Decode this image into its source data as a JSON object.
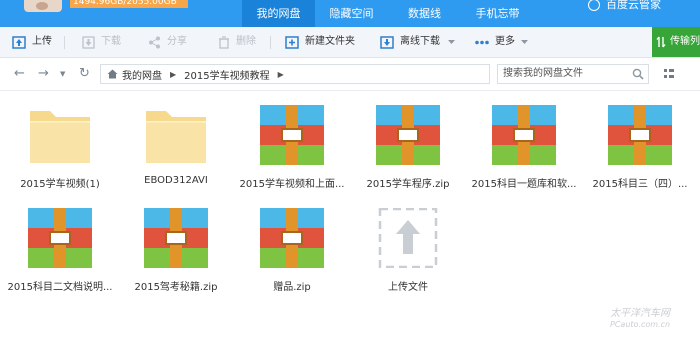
{
  "header": {
    "quota_text": "1494.96GB/2055.00GB",
    "nav": [
      {
        "label": "我的网盘",
        "active": true
      },
      {
        "label": "隐藏空间",
        "active": false
      },
      {
        "label": "数据线",
        "active": false
      },
      {
        "label": "手机忘带",
        "active": false
      }
    ],
    "right_text": "百度云管家"
  },
  "toolbar": {
    "upload": "上传",
    "download": "下载",
    "share": "分享",
    "delete": "删除",
    "new_folder": "新建文件夹",
    "offline_download": "离线下载",
    "more": "更多",
    "transfer_list": "传输列"
  },
  "address": {
    "crumbs": [
      "我的网盘",
      "2015学车视频教程"
    ],
    "search_placeholder": "搜索我的网盘文件"
  },
  "files": [
    {
      "name": "2015学车视频(1)",
      "type": "folder"
    },
    {
      "name": "EBOD312AVI",
      "type": "folder"
    },
    {
      "name": "2015学车视频和上面...",
      "type": "archive"
    },
    {
      "name": "2015学车程序.zip",
      "type": "archive"
    },
    {
      "name": "2015科目一题库和软...",
      "type": "archive"
    },
    {
      "name": "2015科目三（四）...",
      "type": "archive"
    },
    {
      "name": "2015科目二文档说明...",
      "type": "archive"
    },
    {
      "name": "2015驾考秘籍.zip",
      "type": "archive"
    },
    {
      "name": "赠品.zip",
      "type": "archive"
    },
    {
      "name": "上传文件",
      "type": "upload"
    }
  ],
  "watermark": {
    "line1": "太平洋汽车网",
    "line2": "PCauto.com.cn"
  },
  "colors": {
    "header": "#2e9bf0",
    "active_tab": "#1a82d8",
    "upload_green": "#37a537"
  }
}
